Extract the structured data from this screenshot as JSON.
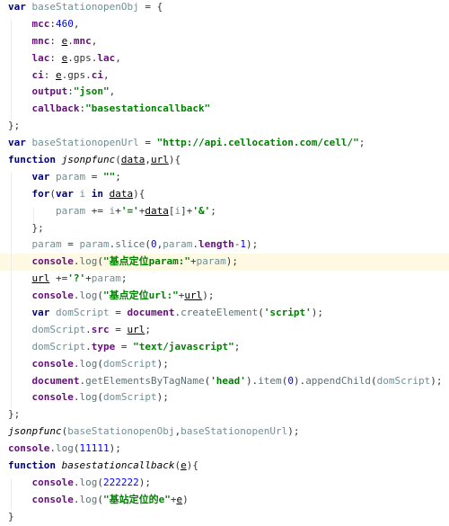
{
  "editor": {
    "highlighted_line": 16,
    "colors": {
      "keyword": "#000080",
      "variable": "#6f8f95",
      "property": "#660e7a",
      "string": "#008000",
      "number": "#0000ff",
      "highlight": "#fdf9e2"
    },
    "lines": [
      [
        [
          "kw",
          "var"
        ],
        [
          "p",
          " "
        ],
        [
          "var",
          "baseStationopenObj"
        ],
        [
          "p",
          " = {"
        ]
      ],
      [
        [
          "p",
          "    "
        ],
        [
          "prop",
          "mcc"
        ],
        [
          "p",
          ":"
        ],
        [
          "num",
          "460"
        ],
        [
          "p",
          ","
        ]
      ],
      [
        [
          "p",
          "    "
        ],
        [
          "prop",
          "mnc"
        ],
        [
          "p",
          ": "
        ],
        [
          "u",
          "e"
        ],
        [
          "p",
          "."
        ],
        [
          "prop",
          "mnc"
        ],
        [
          "p",
          ","
        ]
      ],
      [
        [
          "p",
          "    "
        ],
        [
          "prop",
          "lac"
        ],
        [
          "p",
          ": "
        ],
        [
          "u",
          "e"
        ],
        [
          "p",
          ".gps."
        ],
        [
          "prop",
          "lac"
        ],
        [
          "p",
          ","
        ]
      ],
      [
        [
          "p",
          "    "
        ],
        [
          "prop",
          "ci"
        ],
        [
          "p",
          ": "
        ],
        [
          "u",
          "e"
        ],
        [
          "p",
          ".gps."
        ],
        [
          "prop",
          "ci"
        ],
        [
          "p",
          ","
        ]
      ],
      [
        [
          "p",
          "    "
        ],
        [
          "prop",
          "output"
        ],
        [
          "p",
          ":"
        ],
        [
          "str",
          "\"json\""
        ],
        [
          "p",
          ","
        ]
      ],
      [
        [
          "p",
          "    "
        ],
        [
          "prop",
          "callback"
        ],
        [
          "p",
          ":"
        ],
        [
          "str",
          "\"basestationcallback\""
        ]
      ],
      [
        [
          "p",
          "};"
        ]
      ],
      [
        [
          "kw",
          "var"
        ],
        [
          "p",
          " "
        ],
        [
          "var",
          "baseStationopenUrl"
        ],
        [
          "p",
          " = "
        ],
        [
          "str",
          "\"http://api.cellocation.com/cell/\""
        ],
        [
          "p",
          ";"
        ]
      ],
      [
        [
          "kw",
          "function"
        ],
        [
          "p",
          " "
        ],
        [
          "fn",
          "jsonpfunc"
        ],
        [
          "p",
          "("
        ],
        [
          "u",
          "data"
        ],
        [
          "p",
          ","
        ],
        [
          "u",
          "url"
        ],
        [
          "p",
          "){"
        ]
      ],
      [
        [
          "p",
          "    "
        ],
        [
          "kw",
          "var"
        ],
        [
          "p",
          " "
        ],
        [
          "var",
          "param"
        ],
        [
          "p",
          " = "
        ],
        [
          "str",
          "\"\""
        ],
        [
          "p",
          ";"
        ]
      ],
      [
        [
          "p",
          "    "
        ],
        [
          "kw",
          "for"
        ],
        [
          "p",
          "("
        ],
        [
          "kw",
          "var"
        ],
        [
          "p",
          " "
        ],
        [
          "var",
          "i"
        ],
        [
          "p",
          " "
        ],
        [
          "kw",
          "in"
        ],
        [
          "p",
          " "
        ],
        [
          "u",
          "data"
        ],
        [
          "p",
          "){"
        ]
      ],
      [
        [
          "p",
          "        "
        ],
        [
          "var",
          "param"
        ],
        [
          "p",
          " += "
        ],
        [
          "var",
          "i"
        ],
        [
          "p",
          "+"
        ],
        [
          "str",
          "'='"
        ],
        [
          "p",
          "+"
        ],
        [
          "u",
          "data"
        ],
        [
          "p",
          "["
        ],
        [
          "var",
          "i"
        ],
        [
          "p",
          "]+"
        ],
        [
          "str",
          "'&'"
        ],
        [
          "p",
          ";"
        ]
      ],
      [
        [
          "p",
          "    };"
        ]
      ],
      [
        [
          "p",
          "    "
        ],
        [
          "var",
          "param"
        ],
        [
          "p",
          " = "
        ],
        [
          "var",
          "param"
        ],
        [
          "p",
          "."
        ],
        [
          "m",
          "slice"
        ],
        [
          "p",
          "("
        ],
        [
          "num",
          "0"
        ],
        [
          "p",
          ","
        ],
        [
          "var",
          "param"
        ],
        [
          "p",
          "."
        ],
        [
          "prop",
          "length"
        ],
        [
          "p",
          "-"
        ],
        [
          "num",
          "1"
        ],
        [
          "p",
          ");"
        ]
      ],
      [
        [
          "p",
          "    "
        ],
        [
          "prop",
          "console"
        ],
        [
          "p",
          "."
        ],
        [
          "m",
          "log"
        ],
        [
          "p",
          "("
        ],
        [
          "str",
          "\"基点定位param:\""
        ],
        [
          "p",
          "+"
        ],
        [
          "var",
          "param"
        ],
        [
          "p",
          ");"
        ]
      ],
      [
        [
          "p",
          "    "
        ],
        [
          "u",
          "url"
        ],
        [
          "p",
          " +="
        ],
        [
          "str",
          "'?'"
        ],
        [
          "p",
          "+"
        ],
        [
          "var",
          "param"
        ],
        [
          "p",
          ";"
        ]
      ],
      [
        [
          "p",
          "    "
        ],
        [
          "prop",
          "console"
        ],
        [
          "p",
          "."
        ],
        [
          "m",
          "log"
        ],
        [
          "p",
          "("
        ],
        [
          "str",
          "\"基点定位url:\""
        ],
        [
          "p",
          "+"
        ],
        [
          "u",
          "url"
        ],
        [
          "p",
          ");"
        ]
      ],
      [
        [
          "p",
          "    "
        ],
        [
          "kw",
          "var"
        ],
        [
          "p",
          " "
        ],
        [
          "var",
          "domScript"
        ],
        [
          "p",
          " = "
        ],
        [
          "prop",
          "document"
        ],
        [
          "p",
          "."
        ],
        [
          "m",
          "createElement"
        ],
        [
          "p",
          "("
        ],
        [
          "str",
          "'script'"
        ],
        [
          "p",
          ");"
        ]
      ],
      [
        [
          "p",
          "    "
        ],
        [
          "var",
          "domScript"
        ],
        [
          "p",
          "."
        ],
        [
          "prop",
          "src"
        ],
        [
          "p",
          " = "
        ],
        [
          "u",
          "url"
        ],
        [
          "p",
          ";"
        ]
      ],
      [
        [
          "p",
          "    "
        ],
        [
          "var",
          "domScript"
        ],
        [
          "p",
          "."
        ],
        [
          "prop",
          "type"
        ],
        [
          "p",
          " = "
        ],
        [
          "str",
          "\"text/javascript\""
        ],
        [
          "p",
          ";"
        ]
      ],
      [
        [
          "p",
          "    "
        ],
        [
          "prop",
          "console"
        ],
        [
          "p",
          "."
        ],
        [
          "m",
          "log"
        ],
        [
          "p",
          "("
        ],
        [
          "var",
          "domScript"
        ],
        [
          "p",
          ");"
        ]
      ],
      [
        [
          "p",
          "    "
        ],
        [
          "prop",
          "document"
        ],
        [
          "p",
          "."
        ],
        [
          "m",
          "getElementsByTagName"
        ],
        [
          "p",
          "("
        ],
        [
          "str",
          "'head'"
        ],
        [
          "p",
          ")."
        ],
        [
          "m",
          "item"
        ],
        [
          "p",
          "("
        ],
        [
          "num",
          "0"
        ],
        [
          "p",
          ")."
        ],
        [
          "m",
          "appendChild"
        ],
        [
          "p",
          "("
        ],
        [
          "var",
          "domScript"
        ],
        [
          "p",
          ");"
        ]
      ],
      [
        [
          "p",
          "    "
        ],
        [
          "prop",
          "console"
        ],
        [
          "p",
          "."
        ],
        [
          "m",
          "log"
        ],
        [
          "p",
          "("
        ],
        [
          "var",
          "domScript"
        ],
        [
          "p",
          ");"
        ]
      ],
      [
        [
          "p",
          "};"
        ]
      ],
      [
        [
          "fn",
          "jsonpfunc"
        ],
        [
          "p",
          "("
        ],
        [
          "var",
          "baseStationopenObj"
        ],
        [
          "p",
          ","
        ],
        [
          "var",
          "baseStationopenUrl"
        ],
        [
          "p",
          ");"
        ]
      ],
      [
        [
          "prop",
          "console"
        ],
        [
          "p",
          "."
        ],
        [
          "m",
          "log"
        ],
        [
          "p",
          "("
        ],
        [
          "num",
          "11111"
        ],
        [
          "p",
          ");"
        ]
      ],
      [
        [
          "kw",
          "function"
        ],
        [
          "p",
          " "
        ],
        [
          "fn",
          "basestationcallback"
        ],
        [
          "p",
          "("
        ],
        [
          "u",
          "e"
        ],
        [
          "p",
          "){"
        ]
      ],
      [
        [
          "p",
          "    "
        ],
        [
          "prop",
          "console"
        ],
        [
          "p",
          "."
        ],
        [
          "m",
          "log"
        ],
        [
          "p",
          "("
        ],
        [
          "num",
          "222222"
        ],
        [
          "p",
          ");"
        ]
      ],
      [
        [
          "p",
          "    "
        ],
        [
          "prop",
          "console"
        ],
        [
          "p",
          "."
        ],
        [
          "m",
          "log"
        ],
        [
          "p",
          "("
        ],
        [
          "str",
          "\"基站定位的e\""
        ],
        [
          "p",
          "+"
        ],
        [
          "u",
          "e"
        ],
        [
          "p",
          ")"
        ]
      ],
      [
        [
          "p",
          "}"
        ]
      ]
    ]
  }
}
